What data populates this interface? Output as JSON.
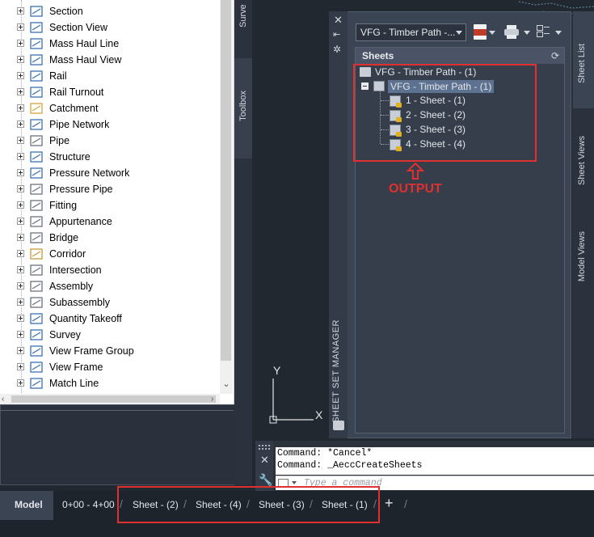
{
  "tree": {
    "items": [
      {
        "label": "Section",
        "icon": "section-icon"
      },
      {
        "label": "Section View",
        "icon": "section-view-icon"
      },
      {
        "label": "Mass Haul Line",
        "icon": "mass-haul-line-icon"
      },
      {
        "label": "Mass Haul View",
        "icon": "mass-haul-view-icon"
      },
      {
        "label": "Rail",
        "icon": "rail-icon"
      },
      {
        "label": "Rail Turnout",
        "icon": "rail-turnout-icon"
      },
      {
        "label": "Catchment",
        "icon": "catchment-icon"
      },
      {
        "label": "Pipe Network",
        "icon": "pipe-network-icon"
      },
      {
        "label": "Pipe",
        "icon": "pipe-icon"
      },
      {
        "label": "Structure",
        "icon": "structure-icon"
      },
      {
        "label": "Pressure Network",
        "icon": "pressure-network-icon"
      },
      {
        "label": "Pressure Pipe",
        "icon": "pressure-pipe-icon"
      },
      {
        "label": "Fitting",
        "icon": "fitting-icon"
      },
      {
        "label": "Appurtenance",
        "icon": "appurtenance-icon"
      },
      {
        "label": "Bridge",
        "icon": "bridge-icon"
      },
      {
        "label": "Corridor",
        "icon": "corridor-icon"
      },
      {
        "label": "Intersection",
        "icon": "intersection-icon"
      },
      {
        "label": "Assembly",
        "icon": "assembly-icon"
      },
      {
        "label": "Subassembly",
        "icon": "subassembly-icon"
      },
      {
        "label": "Quantity Takeoff",
        "icon": "quantity-takeoff-icon"
      },
      {
        "label": "Survey",
        "icon": "survey-icon"
      },
      {
        "label": "View Frame Group",
        "icon": "view-frame-group-icon"
      },
      {
        "label": "View Frame",
        "icon": "view-frame-icon"
      },
      {
        "label": "Match Line",
        "icon": "match-line-icon"
      }
    ]
  },
  "side_tabs": {
    "survey": "Surve",
    "toolbox": "Toolbox"
  },
  "ssm": {
    "title": "SHEET SET MANAGER",
    "combo_value": "VFG - Timber Path -...",
    "panel_header": "Sheets",
    "root": "VFG - Timber Path - (1)",
    "subset": "VFG - Timber Path - (1)",
    "sheets": [
      "1 - Sheet - (1)",
      "2 - Sheet - (2)",
      "3 - Sheet - (3)",
      "4 - Sheet - (4)"
    ],
    "right_tabs": [
      "Sheet List",
      "Sheet Views",
      "Model Views"
    ]
  },
  "annotation": {
    "output_label": "OUTPUT"
  },
  "ucs": {
    "y_label": "Y",
    "x_label": "X"
  },
  "command": {
    "lines": [
      "Command: *Cancel*",
      "Command: _AeccCreateSheets"
    ],
    "placeholder": "Type a command"
  },
  "layout_tabs": {
    "model": "Model",
    "layouts": [
      "0+00 - 4+00",
      "Sheet - (2)",
      "Sheet - (4)",
      "Sheet - (3)",
      "Sheet - (1)"
    ],
    "add": "+"
  },
  "colors": {
    "highlight": "#e03030",
    "selection": "#5d7190",
    "panel": "#3b4453"
  }
}
